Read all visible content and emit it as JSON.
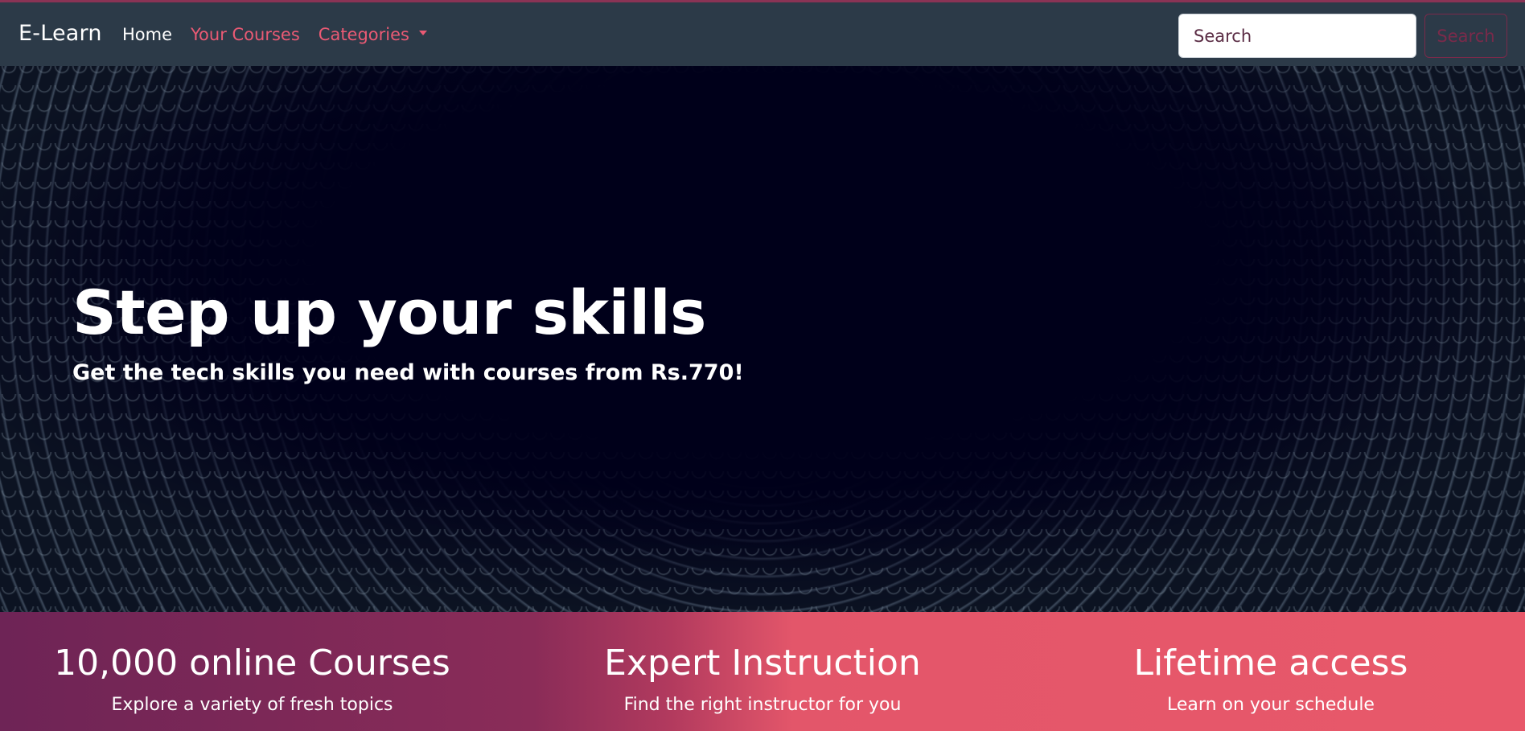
{
  "navbar": {
    "brand": "E-Learn",
    "links": [
      {
        "label": "Home"
      },
      {
        "label": "Your Courses"
      },
      {
        "label": "Categories"
      }
    ],
    "search": {
      "placeholder": "Search",
      "button_label": "Search"
    }
  },
  "hero": {
    "title": "Step up your skills",
    "subtitle": "Get the tech skills you need with courses from Rs.770!"
  },
  "features": [
    {
      "title": "10,000 online Courses",
      "description": "Explore a variety of fresh topics"
    },
    {
      "title": "Expert Instruction",
      "description": "Find the right instructor for you"
    },
    {
      "title": "Lifetime access",
      "description": "Learn on your schedule"
    }
  ],
  "colors": {
    "navbar_bg": "#2c3a48",
    "accent": "#ea5a74",
    "hero_bg": "#00001a",
    "features_gradient_start": "#6e2456",
    "features_gradient_end": "#e8586a"
  },
  "icons": {
    "categories_dropdown": "chevron-down-icon"
  }
}
